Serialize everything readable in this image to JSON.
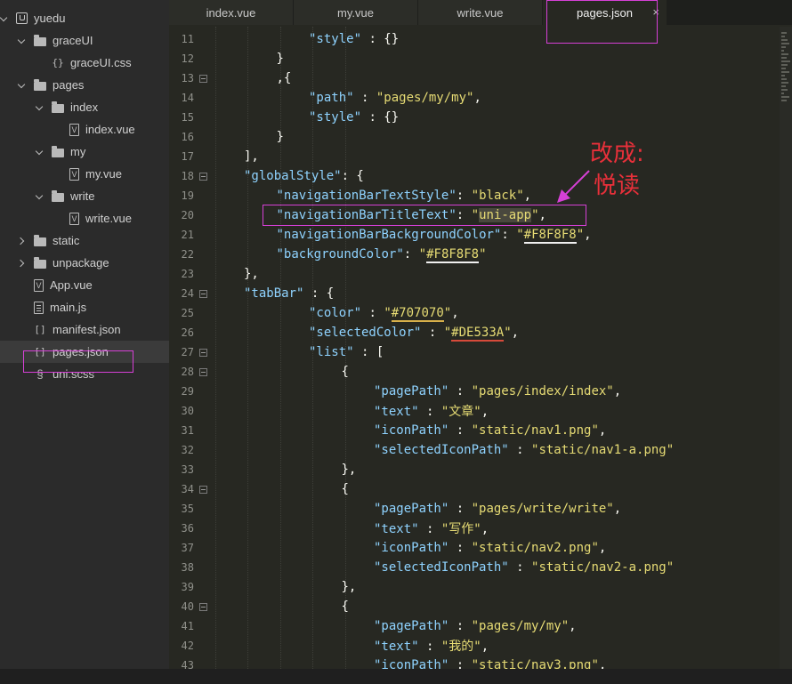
{
  "sidebar": {
    "items": [
      {
        "label": "yuedu",
        "icon": "project-icon",
        "arrow": "down",
        "depth": 0
      },
      {
        "label": "graceUI",
        "icon": "folder-icon",
        "arrow": "down",
        "depth": 1
      },
      {
        "label": "graceUI.css",
        "icon": "css-file-icon",
        "arrow": "none",
        "depth": 2
      },
      {
        "label": "pages",
        "icon": "folder-icon",
        "arrow": "down",
        "depth": 1
      },
      {
        "label": "index",
        "icon": "folder-icon",
        "arrow": "down",
        "depth": 2
      },
      {
        "label": "index.vue",
        "icon": "vue-file-icon",
        "arrow": "none",
        "depth": 3
      },
      {
        "label": "my",
        "icon": "folder-icon",
        "arrow": "down",
        "depth": 2
      },
      {
        "label": "my.vue",
        "icon": "vue-file-icon",
        "arrow": "none",
        "depth": 3
      },
      {
        "label": "write",
        "icon": "folder-icon",
        "arrow": "down",
        "depth": 2
      },
      {
        "label": "write.vue",
        "icon": "vue-file-icon",
        "arrow": "none",
        "depth": 3
      },
      {
        "label": "static",
        "icon": "folder-icon",
        "arrow": "right",
        "depth": 1
      },
      {
        "label": "unpackage",
        "icon": "folder-icon",
        "arrow": "right",
        "depth": 1
      },
      {
        "label": "App.vue",
        "icon": "vue-file-icon",
        "arrow": "none",
        "depth": 1
      },
      {
        "label": "main.js",
        "icon": "js-file-icon",
        "arrow": "none",
        "depth": 1
      },
      {
        "label": "manifest.json",
        "icon": "json-file-icon",
        "arrow": "none",
        "depth": 1
      },
      {
        "label": "pages.json",
        "icon": "json-file-icon",
        "arrow": "none",
        "depth": 1,
        "selected": true
      },
      {
        "label": "uni.scss",
        "icon": "scss-file-icon",
        "arrow": "none",
        "depth": 1
      }
    ]
  },
  "tabs": [
    {
      "label": "index.vue",
      "active": false
    },
    {
      "label": "my.vue",
      "active": false
    },
    {
      "label": "write.vue",
      "active": false
    },
    {
      "label": "pages.json",
      "active": true
    }
  ],
  "tab_close_glyph": "×",
  "editor": {
    "lines": [
      {
        "n": "11",
        "fold": false,
        "indent": 3,
        "tokens": [
          [
            "s",
            "\"style\""
          ],
          [
            "p",
            " : {}"
          ]
        ]
      },
      {
        "n": "12",
        "fold": false,
        "indent": 2,
        "tokens": [
          [
            "p",
            "}"
          ]
        ]
      },
      {
        "n": "13",
        "fold": true,
        "indent": 2,
        "tokens": [
          [
            "p",
            ",{"
          ]
        ]
      },
      {
        "n": "14",
        "fold": false,
        "indent": 3,
        "tokens": [
          [
            "s",
            "\"path\""
          ],
          [
            "p",
            " : "
          ],
          [
            "v",
            "\"pages/my/my\""
          ],
          [
            "p",
            ","
          ]
        ]
      },
      {
        "n": "15",
        "fold": false,
        "indent": 3,
        "tokens": [
          [
            "s",
            "\"style\""
          ],
          [
            "p",
            " : {}"
          ]
        ]
      },
      {
        "n": "16",
        "fold": false,
        "indent": 2,
        "tokens": [
          [
            "p",
            "}"
          ]
        ]
      },
      {
        "n": "17",
        "fold": false,
        "indent": 1,
        "tokens": [
          [
            "p",
            "],"
          ]
        ]
      },
      {
        "n": "18",
        "fold": true,
        "indent": 1,
        "tokens": [
          [
            "s",
            "\"globalStyle\""
          ],
          [
            "p",
            ": {"
          ]
        ]
      },
      {
        "n": "19",
        "fold": false,
        "indent": 2,
        "tokens": [
          [
            "s",
            "\"navigationBarTextStyle\""
          ],
          [
            "p",
            ": "
          ],
          [
            "v",
            "\"black\""
          ],
          [
            "p",
            ","
          ]
        ]
      },
      {
        "n": "20",
        "fold": false,
        "indent": 2,
        "tokens": [
          [
            "s",
            "\"navigationBarTitleText\""
          ],
          [
            "p",
            ": "
          ],
          [
            "v",
            "\""
          ],
          [
            "vsel",
            "uni-app"
          ],
          [
            "v",
            "\""
          ],
          [
            "p",
            ","
          ]
        ]
      },
      {
        "n": "21",
        "fold": false,
        "indent": 2,
        "tokens": [
          [
            "s",
            "\"navigationBarBackgroundColor\""
          ],
          [
            "p",
            ": "
          ],
          [
            "v",
            "\""
          ],
          [
            "vuw",
            "#F8F8F8"
          ],
          [
            "v",
            "\""
          ],
          [
            "p",
            ","
          ]
        ]
      },
      {
        "n": "22",
        "fold": false,
        "indent": 2,
        "tokens": [
          [
            "s",
            "\"backgroundColor\""
          ],
          [
            "p",
            ": "
          ],
          [
            "v",
            "\""
          ],
          [
            "vuw",
            "#F8F8F8"
          ],
          [
            "v",
            "\""
          ]
        ]
      },
      {
        "n": "23",
        "fold": false,
        "indent": 1,
        "tokens": [
          [
            "p",
            "},"
          ]
        ]
      },
      {
        "n": "24",
        "fold": true,
        "indent": 1,
        "tokens": [
          [
            "s",
            "\"tabBar\""
          ],
          [
            "p",
            " : {"
          ]
        ]
      },
      {
        "n": "25",
        "fold": false,
        "indent": 3,
        "tokens": [
          [
            "s",
            "\"color\""
          ],
          [
            "p",
            " : "
          ],
          [
            "v",
            "\""
          ],
          [
            "vuy",
            "#707070"
          ],
          [
            "v",
            "\""
          ],
          [
            "p",
            ","
          ]
        ]
      },
      {
        "n": "26",
        "fold": false,
        "indent": 3,
        "tokens": [
          [
            "s",
            "\"selectedColor\""
          ],
          [
            "p",
            " : "
          ],
          [
            "v",
            "\""
          ],
          [
            "vur",
            "#DE533A"
          ],
          [
            "v",
            "\""
          ],
          [
            "p",
            ","
          ]
        ]
      },
      {
        "n": "27",
        "fold": true,
        "indent": 3,
        "tokens": [
          [
            "s",
            "\"list\""
          ],
          [
            "p",
            " : ["
          ]
        ]
      },
      {
        "n": "28",
        "fold": true,
        "indent": 4,
        "tokens": [
          [
            "p",
            "{"
          ]
        ]
      },
      {
        "n": "29",
        "fold": false,
        "indent": 5,
        "tokens": [
          [
            "s",
            "\"pagePath\""
          ],
          [
            "p",
            " : "
          ],
          [
            "v",
            "\"pages/index/index\""
          ],
          [
            "p",
            ","
          ]
        ]
      },
      {
        "n": "30",
        "fold": false,
        "indent": 5,
        "tokens": [
          [
            "s",
            "\"text\""
          ],
          [
            "p",
            " : "
          ],
          [
            "v",
            "\"文章\""
          ],
          [
            "p",
            ","
          ]
        ]
      },
      {
        "n": "31",
        "fold": false,
        "indent": 5,
        "tokens": [
          [
            "s",
            "\"iconPath\""
          ],
          [
            "p",
            " : "
          ],
          [
            "v",
            "\"static/nav1.png\""
          ],
          [
            "p",
            ","
          ]
        ]
      },
      {
        "n": "32",
        "fold": false,
        "indent": 5,
        "tokens": [
          [
            "s",
            "\"selectedIconPath\""
          ],
          [
            "p",
            " : "
          ],
          [
            "v",
            "\"static/nav1-a.png\""
          ]
        ]
      },
      {
        "n": "33",
        "fold": false,
        "indent": 4,
        "tokens": [
          [
            "p",
            "},"
          ]
        ]
      },
      {
        "n": "34",
        "fold": true,
        "indent": 4,
        "tokens": [
          [
            "p",
            "{"
          ]
        ]
      },
      {
        "n": "35",
        "fold": false,
        "indent": 5,
        "tokens": [
          [
            "s",
            "\"pagePath\""
          ],
          [
            "p",
            " : "
          ],
          [
            "v",
            "\"pages/write/write\""
          ],
          [
            "p",
            ","
          ]
        ]
      },
      {
        "n": "36",
        "fold": false,
        "indent": 5,
        "tokens": [
          [
            "s",
            "\"text\""
          ],
          [
            "p",
            " : "
          ],
          [
            "v",
            "\"写作\""
          ],
          [
            "p",
            ","
          ]
        ]
      },
      {
        "n": "37",
        "fold": false,
        "indent": 5,
        "tokens": [
          [
            "s",
            "\"iconPath\""
          ],
          [
            "p",
            " : "
          ],
          [
            "v",
            "\"static/nav2.png\""
          ],
          [
            "p",
            ","
          ]
        ]
      },
      {
        "n": "38",
        "fold": false,
        "indent": 5,
        "tokens": [
          [
            "s",
            "\"selectedIconPath\""
          ],
          [
            "p",
            " : "
          ],
          [
            "v",
            "\"static/nav2-a.png\""
          ]
        ]
      },
      {
        "n": "39",
        "fold": false,
        "indent": 4,
        "tokens": [
          [
            "p",
            "},"
          ]
        ]
      },
      {
        "n": "40",
        "fold": true,
        "indent": 4,
        "tokens": [
          [
            "p",
            "{"
          ]
        ]
      },
      {
        "n": "41",
        "fold": false,
        "indent": 5,
        "tokens": [
          [
            "s",
            "\"pagePath\""
          ],
          [
            "p",
            " : "
          ],
          [
            "v",
            "\"pages/my/my\""
          ],
          [
            "p",
            ","
          ]
        ]
      },
      {
        "n": "42",
        "fold": false,
        "indent": 5,
        "tokens": [
          [
            "s",
            "\"text\""
          ],
          [
            "p",
            " : "
          ],
          [
            "v",
            "\"我的\""
          ],
          [
            "p",
            ","
          ]
        ]
      },
      {
        "n": "43",
        "fold": false,
        "indent": 5,
        "tokens": [
          [
            "s",
            "\"iconPath\""
          ],
          [
            "p",
            " : "
          ],
          [
            "v",
            "\"static/nav3.png\""
          ],
          [
            "p",
            ","
          ]
        ]
      }
    ]
  },
  "annotation": {
    "line1": "改成:",
    "line2": "悦读",
    "color": "#e8303a",
    "box_color": "#d640d6"
  },
  "colors": {
    "string_key": "#8fd3ff",
    "string_value": "#e6db74",
    "background": "#272822",
    "sidebar_bg": "#2b2b2b"
  }
}
